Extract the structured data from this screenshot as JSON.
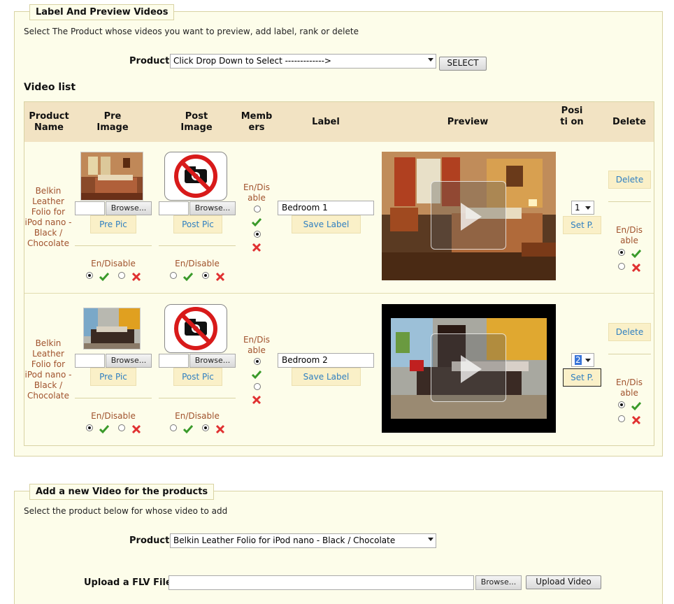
{
  "section1": {
    "legend": "Label And Preview Videos",
    "intro": "Select The Product whose videos you want to preview, add label, rank or delete",
    "product_label": "Product",
    "product_select": "Click Drop Down to Select ------------->",
    "select_button": "SELECT",
    "video_list_title": "Video list",
    "headers": {
      "product_name": "Product Name",
      "pre_image": "Pre Image",
      "post_image": "Post Image",
      "members": "Memb ers",
      "label": "Label",
      "preview": "Preview",
      "position": "Posi ti on",
      "delete": "Delete"
    },
    "rows": [
      {
        "product_name": "Belkin Leather Folio for iPod nano - Black / Chocolate",
        "browse_label": "Browse...",
        "pre_pic_button": "Pre Pic",
        "post_pic_button": "Post Pic",
        "endisable": "En/Disable",
        "members_endisable": "En/Dis able",
        "label_value": "Bedroom 1",
        "save_label_button": "Save Label",
        "position_value": "1",
        "setp_button": "Set P.",
        "delete_button": "Delete",
        "delete_endisable": "En/Dis able"
      },
      {
        "product_name": "Belkin Leather Folio for iPod nano - Black / Chocolate",
        "browse_label": "Browse...",
        "pre_pic_button": "Pre Pic",
        "post_pic_button": "Post Pic",
        "endisable": "En/Disable",
        "members_endisable": "En/Dis able",
        "label_value": "Bedroom 2",
        "save_label_button": "Save Label",
        "position_value": "2",
        "setp_button": "Set P.",
        "delete_button": "Delete",
        "delete_endisable": "En/Dis able"
      }
    ]
  },
  "section2": {
    "legend": "Add a new Video for the products",
    "intro": "Select the product below for whose video to add",
    "product_label": "Product",
    "product_select": "Belkin Leather Folio for iPod nano - Black / Chocolate",
    "upload_label": "Upload a FLV File",
    "browse_label": "Browse...",
    "upload_button": "Upload Video"
  }
}
